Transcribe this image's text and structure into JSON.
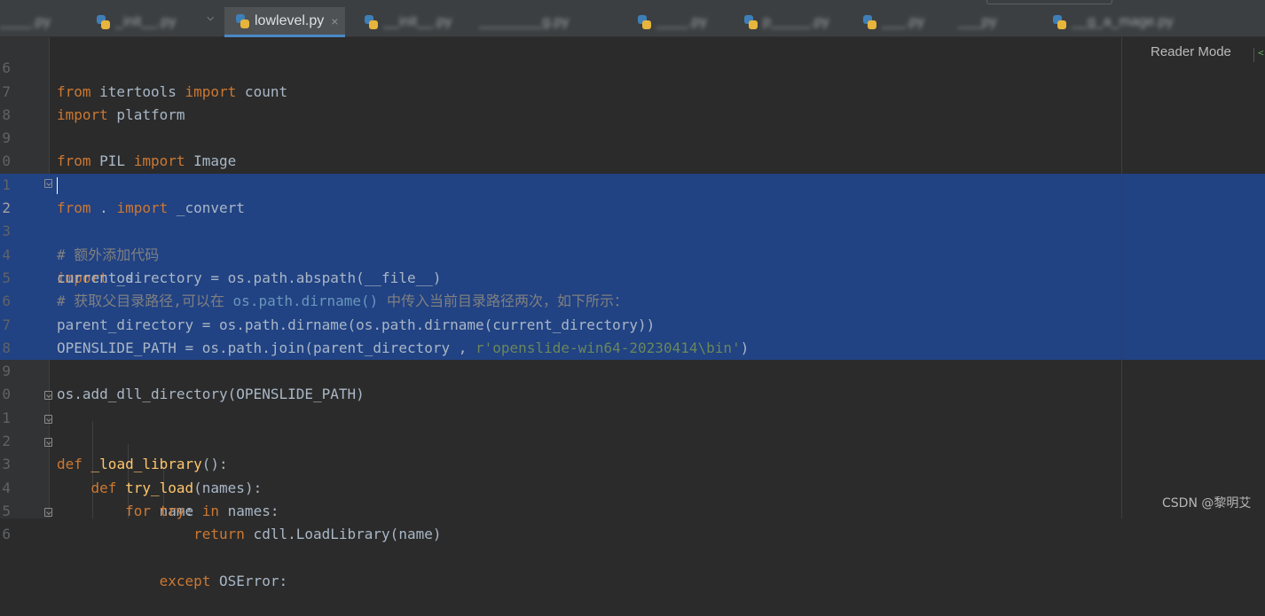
{
  "tabs": [
    {
      "label": "____.py"
    },
    {
      "label": "_init__.py"
    },
    {
      "label": "lowlevel.py",
      "active": true
    },
    {
      "label": "__init__.py"
    },
    {
      "label": "________g.py"
    },
    {
      "label": "____.py"
    },
    {
      "label": "p_____.py"
    },
    {
      "label": "___.py"
    },
    {
      "label": "___py"
    },
    {
      "label": "__g_a_mage.py"
    }
  ],
  "active_tab": {
    "label": "lowlevel.py",
    "close": "×"
  },
  "reader_mode": "Reader Mode",
  "watermark": "CSDN @黎明艾",
  "colors": {
    "selection": "#214283",
    "keyword": "#cc7832",
    "function": "#ffc66d",
    "string": "#6a8759",
    "comment": "#808080"
  },
  "code": {
    "l6": {
      "num": "6",
      "kw1": "from",
      "t1": " itertools ",
      "kw2": "import",
      "t2": " count"
    },
    "l7": {
      "num": "7",
      "kw1": "import",
      "t1": " platform"
    },
    "l8": {
      "num": "8"
    },
    "l9": {
      "num": "9",
      "kw1": "from",
      "t1": " PIL ",
      "kw2": "import",
      "t2": " Image"
    },
    "l10": {
      "num": "0"
    },
    "l11": {
      "num": "1",
      "kw1": "from",
      "t1": " . ",
      "kw2": "import",
      "t2": " _convert"
    },
    "l12": {
      "num": "2",
      "kw1": "import",
      "t1": " os"
    },
    "l13": {
      "num": "3",
      "comment": "# 额外添加代码"
    },
    "l14": {
      "num": "4",
      "t1": "current_directory = os.path.abspath(__file__)"
    },
    "l15": {
      "num": "5",
      "comment1": "# 获取父目录路径,可以在 ",
      "inline": "os.path.dirname()",
      "comment2": " 中传入当前目录路径两次，如下所示："
    },
    "l16": {
      "num": "6",
      "t1": "parent_directory = os.path.dirname(os.path.dirname(current_directory))"
    },
    "l17": {
      "num": "7",
      "t1": "OPENSLIDE_PATH = os.path.join(parent_directory , ",
      "str": "r'openslide-win64-20230414\\bin'",
      "t2": ")"
    },
    "l18": {
      "num": "8"
    },
    "l19": {
      "num": "9",
      "t1": "os.add_dll_directory(OPENSLIDE_PATH)"
    },
    "l20": {
      "num": "0"
    },
    "l21": {
      "num": "1",
      "kw1": "def",
      "fn": " _load_library",
      "t1": "():"
    },
    "l22": {
      "num": "2",
      "indent": "    ",
      "kw1": "def",
      "fn": " try_load",
      "t1": "(names):"
    },
    "l23": {
      "num": "3",
      "indent": "        ",
      "kw1": "for",
      "t1": " name ",
      "kw2": "in",
      "t2": " names:"
    },
    "l24": {
      "num": "4",
      "indent": "            ",
      "kw1": "try",
      "t1": ":"
    },
    "l25": {
      "num": "5",
      "indent": "                ",
      "kw1": "return",
      "t1": " cdll.LoadLibrary(name)"
    },
    "l26": {
      "num": "6",
      "indent": "            ",
      "kw1": "except",
      "t1": " OSError:"
    }
  }
}
